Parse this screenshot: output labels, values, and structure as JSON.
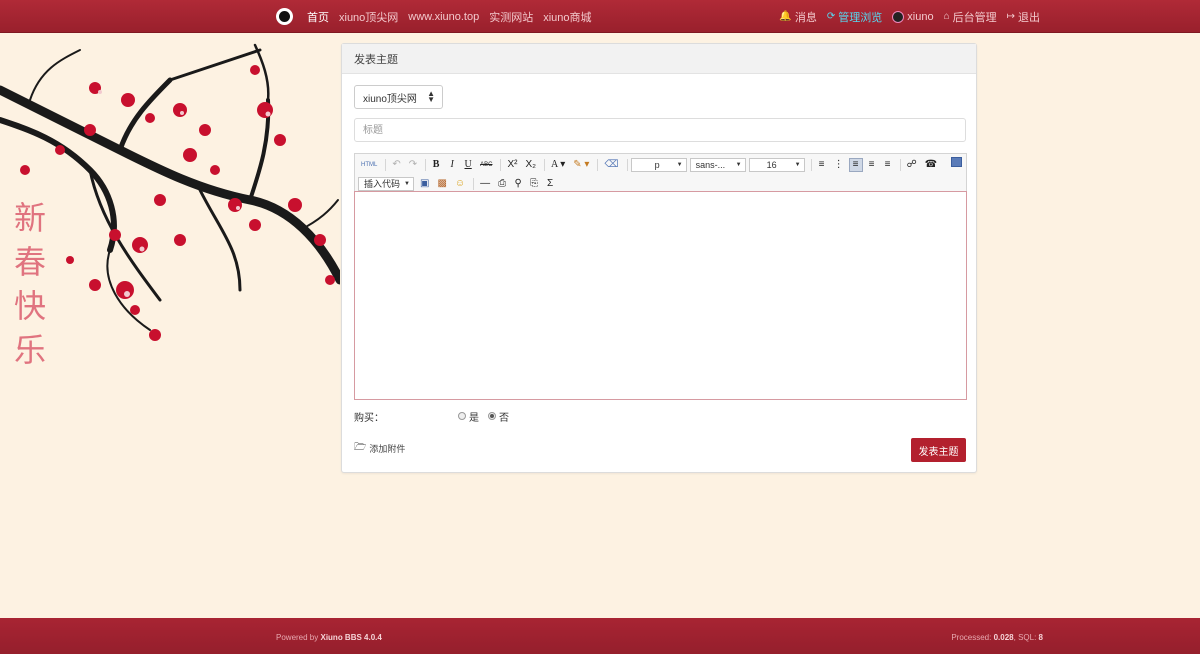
{
  "nav": {
    "links": [
      "首页",
      "xiuno顶尖网",
      "www.xiuno.top",
      "实测网站",
      "xiuno商城"
    ],
    "right": {
      "message": "消息",
      "mode": "管理浏览",
      "user": "xiuno",
      "admin": "后台管理",
      "logout": "退出"
    },
    "colors": {
      "bar": "#a8232f",
      "highlight": "#56d8f0"
    }
  },
  "decoration": {
    "vertical_text": [
      "新",
      "春",
      "快",
      "乐"
    ]
  },
  "card": {
    "header": "发表主题",
    "forum_select": "xiuno顶尖网",
    "title_placeholder": "标题"
  },
  "toolbar": {
    "combos": {
      "paragraph": "p",
      "font_family": "sans-...",
      "font_size": "16",
      "insert_code": "插入代码"
    },
    "icons": [
      "html-source-icon",
      "undo-icon",
      "redo-icon",
      "bold-icon",
      "italic-icon",
      "underline-icon",
      "strikethrough-icon",
      "superscript-icon",
      "subscript-icon",
      "font-color-icon",
      "highlight-icon",
      "eraser-icon",
      "ordered-list-icon",
      "unordered-list-icon",
      "align-left-icon",
      "align-center-icon",
      "align-right-icon",
      "link-icon",
      "unlink-icon",
      "fullscreen-icon",
      "image-icon",
      "picture-icon",
      "emoji-icon",
      "horizontal-rule-icon",
      "print-icon",
      "preview-icon",
      "paste-icon",
      "formula-icon"
    ]
  },
  "form": {
    "buy_label": "购买：",
    "yes": "是",
    "no": "否",
    "selected": "否",
    "attach": "添加附件",
    "submit": "发表主题"
  },
  "footer": {
    "powered_prefix": "Powered by",
    "powered_name": "Xiuno BBS 4.0.4",
    "processed_prefix": "Processed:",
    "processed_value": "0.028",
    "sql_prefix": ", SQL:",
    "sql_value": "8"
  }
}
